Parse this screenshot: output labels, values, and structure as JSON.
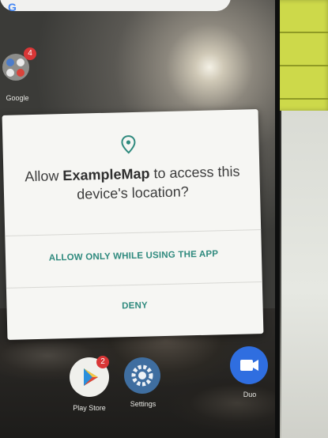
{
  "dialog": {
    "title_prefix": "Allow ",
    "app_name": "ExampleMap",
    "title_suffix": " to access this device's location?",
    "allow_button": "ALLOW ONLY WHILE USING THE APP",
    "deny_button": "DENY",
    "accent_color": "#2f8a7e"
  },
  "home": {
    "folder_label": "Google",
    "folder_badge": "4",
    "dock": [
      {
        "label": "Play Store",
        "icon": "play-store-icon",
        "badge": "2"
      },
      {
        "label": "Settings",
        "icon": "settings-gear-icon"
      },
      {
        "label": "Duo",
        "icon": "video-camera-icon"
      }
    ]
  },
  "search": {
    "logo": "G"
  }
}
